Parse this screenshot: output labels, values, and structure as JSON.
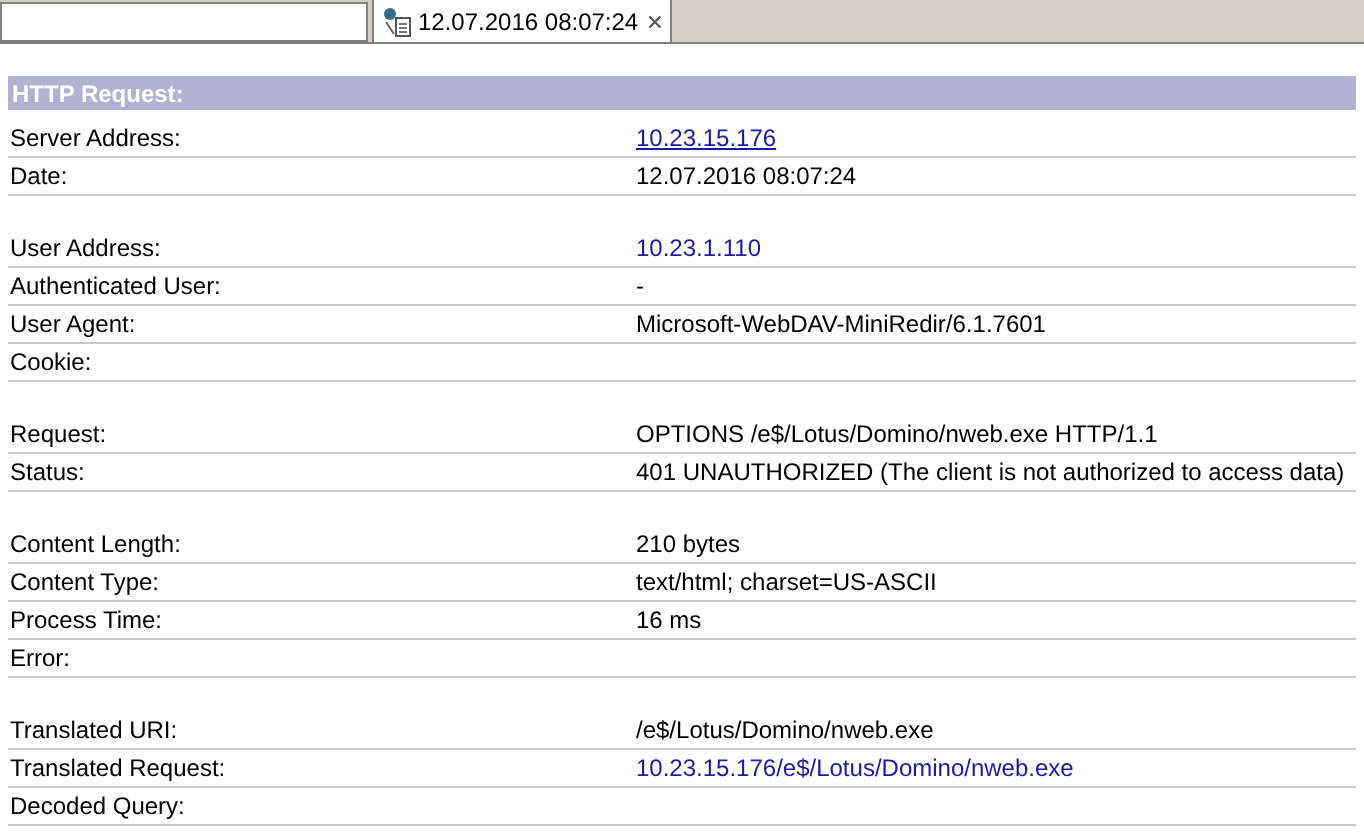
{
  "tabs": [
    {
      "selected": false
    },
    {
      "label": "12.07.2016 08:07:24",
      "selected": true
    }
  ],
  "section": {
    "title": "HTTP Request:"
  },
  "groups": [
    [
      {
        "label": "Server Address:",
        "value": "10.23.15.176",
        "kind": "link",
        "underlined": true
      },
      {
        "label": "Date:",
        "value": "12.07.2016 08:07:24",
        "kind": "plain"
      }
    ],
    [
      {
        "label": "User Address:",
        "value": "10.23.1.110",
        "kind": "link",
        "underlined": false
      },
      {
        "label": "Authenticated User:",
        "value": "-",
        "kind": "plain"
      },
      {
        "label": "User Agent:",
        "value": "Microsoft-WebDAV-MiniRedir/6.1.7601",
        "kind": "plain"
      },
      {
        "label": "Cookie:"
      }
    ],
    [
      {
        "label": "Request:",
        "value": "OPTIONS /e$/Lotus/Domino/nweb.exe HTTP/1.1",
        "kind": "plain"
      },
      {
        "label": "Status:",
        "value": "401 UNAUTHORIZED (The client is not authorized to access data)",
        "kind": "plain"
      }
    ],
    [
      {
        "label": "Content Length:",
        "value": "210 bytes",
        "kind": "plain"
      },
      {
        "label": "Content Type:",
        "value": "text/html; charset=US-ASCII",
        "kind": "plain"
      },
      {
        "label": "Process Time:",
        "value": "16 ms",
        "kind": "plain"
      },
      {
        "label": "Error:"
      }
    ],
    [
      {
        "label": "Translated URI:",
        "value": "/e$/Lotus/Domino/nweb.exe",
        "kind": "plain"
      },
      {
        "label": "Translated Request:",
        "value": "10.23.15.176/e$/Lotus/Domino/nweb.exe",
        "kind": "link",
        "underlined": false
      },
      {
        "label": "Decoded Query:"
      }
    ]
  ]
}
